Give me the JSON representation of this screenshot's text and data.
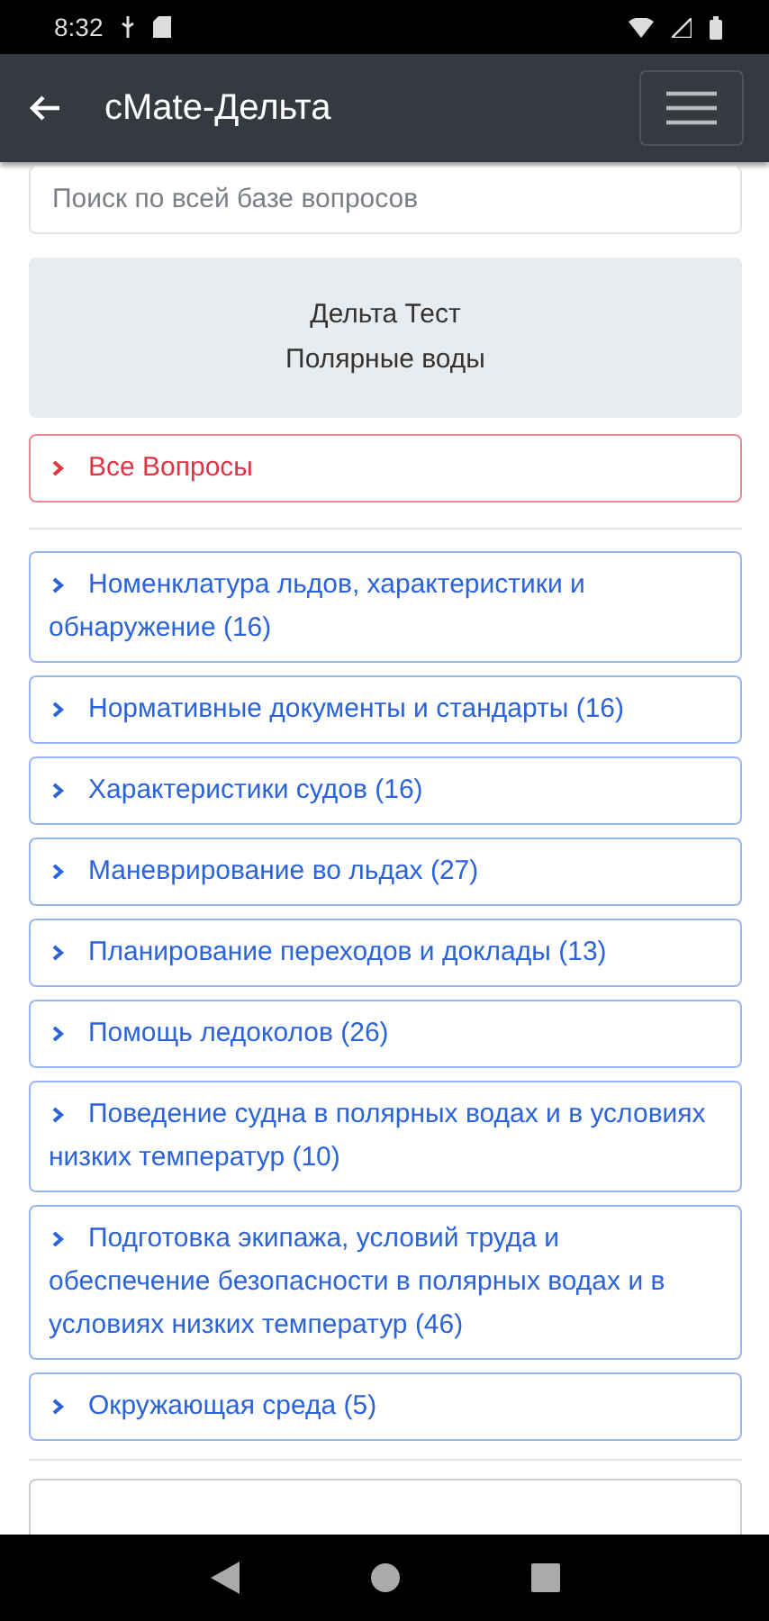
{
  "status_bar": {
    "time": "8:32"
  },
  "app_bar": {
    "title": "cMate-Дельта"
  },
  "search": {
    "placeholder": "Поиск по всей базе вопросов"
  },
  "header_card": {
    "lines": [
      "Дельта Тест",
      "Полярные воды"
    ]
  },
  "all_questions": {
    "label": "Все Вопросы",
    "kind": "danger"
  },
  "categories": [
    {
      "label": "Номенклатура льдов, характеристики и обнаружение (16)",
      "kind": "primary"
    },
    {
      "label": "Нормативные документы и стандарты (16)",
      "kind": "primary"
    },
    {
      "label": "Характеристики судов (16)",
      "kind": "primary"
    },
    {
      "label": "Маневрирование во льдах (27)",
      "kind": "primary"
    },
    {
      "label": "Планирование переходов и доклады (13)",
      "kind": "primary"
    },
    {
      "label": "Помощь ледоколов (26)",
      "kind": "primary"
    },
    {
      "label": "Поведение судна в полярных водах и в условиях низких температур (10)",
      "kind": "primary"
    },
    {
      "label": "Подготовка экипажа, условий труда и обеспечение безопасности в полярных водах и в условиях низких температур (46)",
      "kind": "primary"
    },
    {
      "label": "Окружающая среда (5)",
      "kind": "primary"
    }
  ]
}
